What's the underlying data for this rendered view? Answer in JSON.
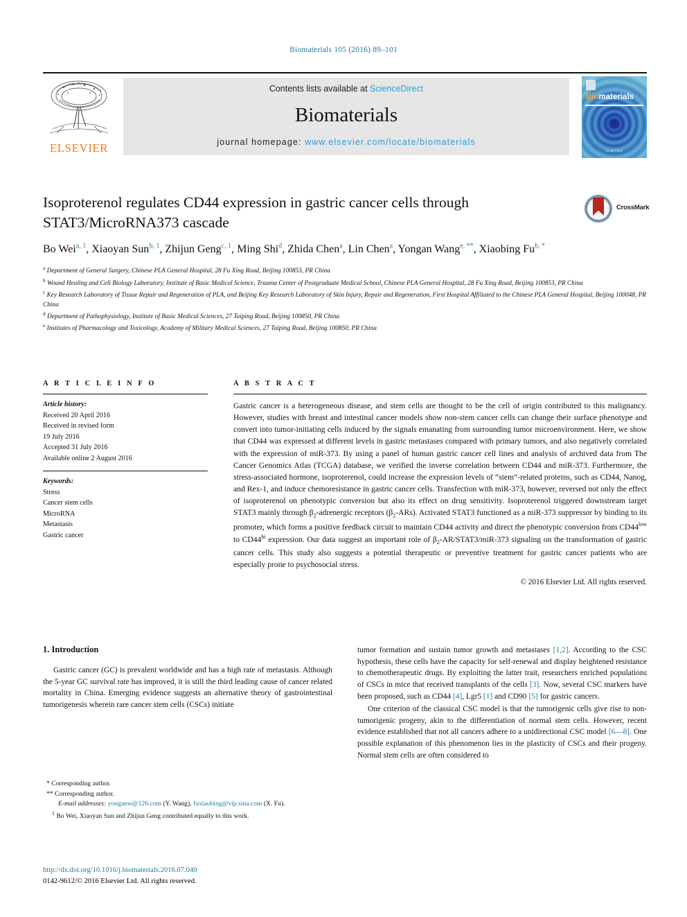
{
  "running_head": "Biomaterials 105 (2016) 89–101",
  "masthead": {
    "contents_line": "Contents lists available at ",
    "sciencedirect": "ScienceDirect",
    "journal_title": "Biomaterials",
    "homepage_label": "journal homepage: ",
    "homepage_url": "www.elsevier.com/locate/biomaterials",
    "publisher": "ELSEVIER",
    "cover_title_b": "Bio",
    "cover_title_rest": "materials",
    "cover_footer": "ELSEVIER"
  },
  "article": {
    "title": "Isoproterenol regulates CD44 expression in gastric cancer cells through STAT3/MicroRNA373 cascade",
    "crossmark_label": "CrossMark",
    "authors_line1": "Bo Wei",
    "authors_line2": "Yongan Wang",
    "authors_full": "Bo Wei a, 1, Xiaoyan Sun b, 1, Zhijun Geng c, 1, Ming Shi d, Zhida Chen a, Lin Chen a, Yongan Wang e, **, Xiaobing Fu b, *",
    "affiliations": [
      {
        "mark": "a",
        "text": "Department of General Surgery, Chinese PLA General Hospital, 28 Fu Xing Road, Beijing 100853, PR China"
      },
      {
        "mark": "b",
        "text": "Wound Healing and Cell Biology Laboratory, Institute of Basic Medical Science, Trauma Center of Postgraduate Medical School, Chinese PLA General Hospital, 28 Fu Xing Road, Beijing 100853, PR China"
      },
      {
        "mark": "c",
        "text": "Key Research Laboratory of Tissue Repair and Regeneration of PLA, and Beijing Key Research Laboratory of Skin Injury, Repair and Regeneration, First Hospital Affiliated to the Chinese PLA General Hospital, Beijing 100048, PR China"
      },
      {
        "mark": "d",
        "text": "Department of Pathophysiology, Institute of Basic Medical Sciences, 27 Taiping Road, Beijing 100850, PR China"
      },
      {
        "mark": "e",
        "text": "Institutes of Pharmacology and Toxicology, Academy of Military Medical Sciences, 27 Taiping Road, Beijing 100850, PR China"
      }
    ]
  },
  "article_info": {
    "heading": "A R T I C L E  I N F O",
    "history_label": "Article history:",
    "history": [
      "Received 20 April 2016",
      "Received in revised form",
      "19 July 2016",
      "Accepted 31 July 2016",
      "Available online 2 August 2016"
    ],
    "keywords_label": "Keywords:",
    "keywords": [
      "Stress",
      "Cancer stem cells",
      "MicroRNA",
      "Metastasis",
      "Gastric cancer"
    ]
  },
  "abstract": {
    "heading": "A B S T R A C T",
    "copyright": "© 2016 Elsevier Ltd. All rights reserved."
  },
  "introduction": {
    "heading": "1.  Introduction"
  },
  "footnotes": {
    "corr1": "* Corresponding author.",
    "corr2": "** Corresponding author.",
    "email_label": "E-mail addresses:",
    "email1": "yonganw@126.com",
    "email1_name": "(Y. Wang),",
    "email2": "fuxiaobing@vip.sina.com",
    "email2_name": "(X. Fu).",
    "equal_contrib": "Bo Wei, Xiaoyan Sun and Zhijun Geng contributed equally to this work."
  },
  "doi_block": {
    "doi": "http://dx.doi.org/10.1016/j.biomaterials.2016.07.040",
    "issn": "0142-9612/© 2016 Elsevier Ltd. All rights reserved."
  },
  "colors": {
    "link": "#1f7a9c",
    "sciencedirect": "#2a9fd6",
    "elsevier_orange": "#f47b20",
    "crossmark_red": "#b5261e"
  }
}
